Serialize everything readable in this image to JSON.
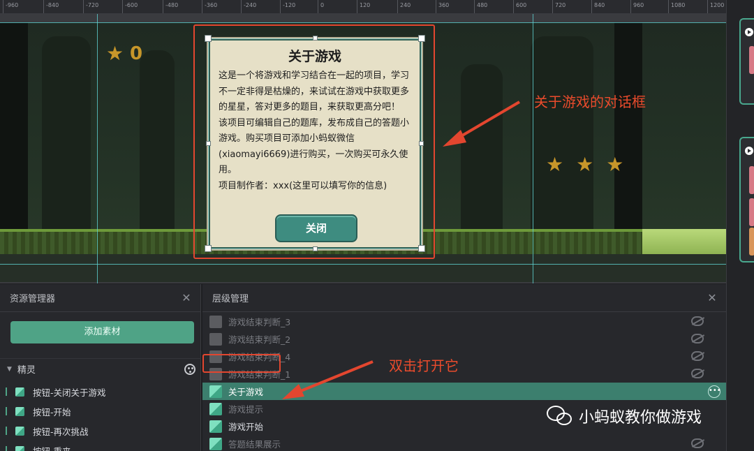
{
  "ruler": {
    "ticks": [
      "-960",
      "-840",
      "-720",
      "-600",
      "-480",
      "-360",
      "-240",
      "-120",
      "0",
      "120",
      "240",
      "360",
      "480",
      "600",
      "720",
      "840",
      "960",
      "1080",
      "1200"
    ]
  },
  "game": {
    "score": "0"
  },
  "dialog": {
    "title": "关于游戏",
    "body": "这是一个将游戏和学习结合在一起的项目，学习不一定非得是枯燥的，来试试在游戏中获取更多的星星，答对更多的题目，来获取更高分吧！\n该项目可编辑自己的题库，发布成自己的答题小游戏。购买项目可添加小蚂蚁微信(xiaomayi6669)进行购买，一次购买可永久使用。\n项目制作者：xxx(这里可以填写你的信息)",
    "close_label": "关闭"
  },
  "annotations": {
    "dialog_note": "关于游戏的对话框",
    "double_click_note": "双击打开它"
  },
  "asset_panel": {
    "title": "资源管理器",
    "add_button": "添加素材",
    "section": "精灵",
    "items": [
      "按钮-关闭关于游戏",
      "按钮-开始",
      "按钮-再次挑战",
      "按钮-重来"
    ]
  },
  "layer_panel": {
    "title": "层级管理",
    "items": [
      {
        "label": "游戏结束判断_3"
      },
      {
        "label": "游戏结束判断_2"
      },
      {
        "label": "游戏结束判断_4"
      },
      {
        "label": "游戏结束判断_1"
      },
      {
        "label": "关于游戏"
      },
      {
        "label": "游戏提示"
      },
      {
        "label": "游戏开始"
      },
      {
        "label": "答题结果展示"
      }
    ]
  },
  "watermark": {
    "text": "小蚂蚁教你做游戏"
  },
  "colors": {
    "accent": "#4fa386",
    "annotation": "#e3462f",
    "selected_row": "#3c7f6e"
  }
}
